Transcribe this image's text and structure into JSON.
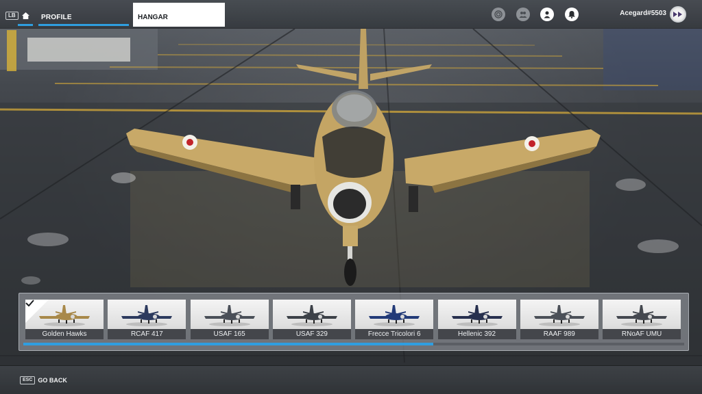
{
  "header": {
    "lb_badge": "LB",
    "tabs": [
      {
        "label": "PROFILE",
        "active": false
      },
      {
        "label": "HANGAR",
        "active": true
      }
    ],
    "icons": [
      "activity-icon",
      "friends-icon",
      "profile-icon",
      "notifications-icon"
    ],
    "username": "Acegard#5503"
  },
  "liveries": {
    "items": [
      {
        "label": "Golden Hawks",
        "selected": true,
        "color": "#a8894a"
      },
      {
        "label": "RCAF 417",
        "selected": false,
        "color": "#2c3a5e"
      },
      {
        "label": "USAF 165",
        "selected": false,
        "color": "#4a4f58"
      },
      {
        "label": "USAF 329",
        "selected": false,
        "color": "#3c4148"
      },
      {
        "label": "Frecce Tricolori 6",
        "selected": false,
        "color": "#223a78"
      },
      {
        "label": "Hellenic 392",
        "selected": false,
        "color": "#27304e"
      },
      {
        "label": "RAAF 989",
        "selected": false,
        "color": "#4b5058"
      },
      {
        "label": "RNoAF UMU",
        "selected": false,
        "color": "#44484f"
      }
    ],
    "scroll_progress": 0.62
  },
  "footer": {
    "esc_badge": "ESC",
    "go_back_label": "GO BACK"
  },
  "colors": {
    "accent": "#2f9ee0",
    "aircraft": "#c8a968"
  }
}
